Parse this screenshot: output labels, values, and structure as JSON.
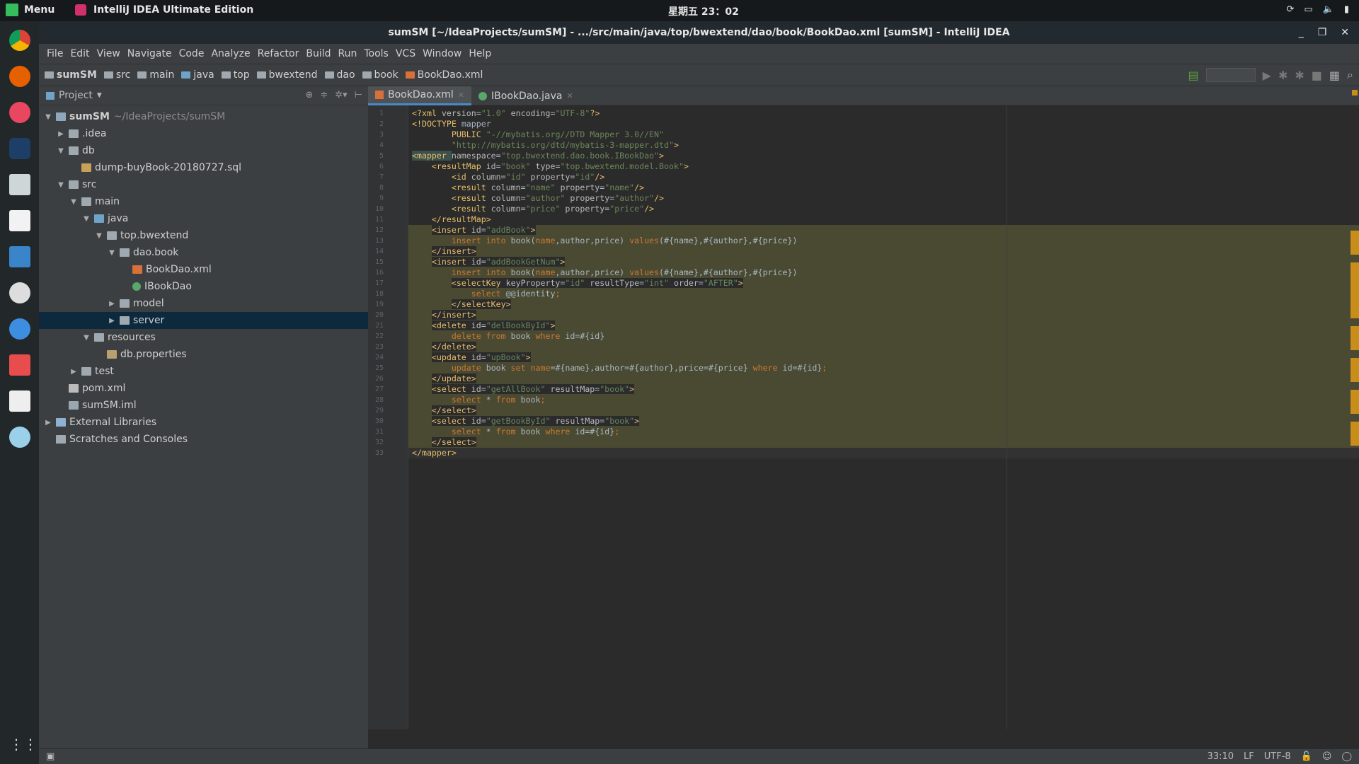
{
  "system_panel": {
    "menu_label": "Menu",
    "app_name": "IntelliJ IDEA Ultimate Edition",
    "clock": "星期五 23：02"
  },
  "window": {
    "title": "sumSM [~/IdeaProjects/sumSM] - .../src/main/java/top/bwextend/dao/book/BookDao.xml [sumSM] - IntelliJ IDEA"
  },
  "menu": [
    "File",
    "Edit",
    "View",
    "Navigate",
    "Code",
    "Analyze",
    "Refactor",
    "Build",
    "Run",
    "Tools",
    "VCS",
    "Window",
    "Help"
  ],
  "breadcrumb": [
    "sumSM",
    "src",
    "main",
    "java",
    "top",
    "bwextend",
    "dao",
    "book",
    "BookDao.xml"
  ],
  "project_panel": {
    "title": "Project",
    "tree": [
      {
        "depth": 0,
        "arrow": "▼",
        "icon": "module",
        "label": "sumSM",
        "note": "~/IdeaProjects/sumSM",
        "bold": true
      },
      {
        "depth": 1,
        "arrow": "▶",
        "icon": "folder",
        "label": ".idea"
      },
      {
        "depth": 1,
        "arrow": "▼",
        "icon": "folder",
        "label": "db"
      },
      {
        "depth": 2,
        "arrow": "",
        "icon": "sql",
        "label": "dump-buyBook-20180727.sql"
      },
      {
        "depth": 1,
        "arrow": "▼",
        "icon": "folder",
        "label": "src"
      },
      {
        "depth": 2,
        "arrow": "▼",
        "icon": "folder",
        "label": "main"
      },
      {
        "depth": 3,
        "arrow": "▼",
        "icon": "source-folder",
        "label": "java"
      },
      {
        "depth": 4,
        "arrow": "▼",
        "icon": "package",
        "label": "top.bwextend"
      },
      {
        "depth": 5,
        "arrow": "▼",
        "icon": "package",
        "label": "dao.book"
      },
      {
        "depth": 6,
        "arrow": "",
        "icon": "xml",
        "label": "BookDao.xml"
      },
      {
        "depth": 6,
        "arrow": "",
        "icon": "interface",
        "label": "IBookDao"
      },
      {
        "depth": 5,
        "arrow": "▶",
        "icon": "package",
        "label": "model"
      },
      {
        "depth": 5,
        "arrow": "▶",
        "icon": "package",
        "label": "server",
        "selected": true
      },
      {
        "depth": 3,
        "arrow": "▼",
        "icon": "resources-folder",
        "label": "resources"
      },
      {
        "depth": 4,
        "arrow": "",
        "icon": "properties",
        "label": "db.properties"
      },
      {
        "depth": 2,
        "arrow": "▶",
        "icon": "folder",
        "label": "test"
      },
      {
        "depth": 1,
        "arrow": "",
        "icon": "maven",
        "label": "pom.xml"
      },
      {
        "depth": 1,
        "arrow": "",
        "icon": "iml",
        "label": "sumSM.iml"
      },
      {
        "depth": 0,
        "arrow": "▶",
        "icon": "libraries",
        "label": "External Libraries"
      },
      {
        "depth": 0,
        "arrow": "",
        "icon": "scratches",
        "label": "Scratches and Consoles"
      }
    ]
  },
  "tabs": [
    {
      "label": "BookDao.xml",
      "active": true,
      "icon": "xml"
    },
    {
      "label": "IBookDao.java",
      "active": false,
      "icon": "interface"
    }
  ],
  "colors": {
    "tag": "#e8bf6a",
    "attr": "#bababa",
    "value": "#6a8759",
    "keyword": "#cc7832",
    "text": "#a9b7c6",
    "highlight": "#4a4a32",
    "marker": "#c98e1a"
  },
  "code": [
    [
      [
        "tag",
        "<?xml "
      ],
      [
        "attr",
        "version"
      ],
      [
        "pl",
        "="
      ],
      [
        "val",
        "\"1.0\""
      ],
      [
        "pl",
        " "
      ],
      [
        "attr",
        "encoding"
      ],
      [
        "pl",
        "="
      ],
      [
        "val",
        "\"UTF-8\""
      ],
      [
        "tag",
        "?>"
      ]
    ],
    [
      [
        "tag",
        "<!DOCTYPE "
      ],
      [
        "txt",
        "mapper"
      ]
    ],
    [
      [
        "sp",
        "        "
      ],
      [
        "tag",
        "PUBLIC "
      ],
      [
        "val",
        "\"-//mybatis.org//DTD Mapper 3.0//EN\""
      ]
    ],
    [
      [
        "sp",
        "        "
      ],
      [
        "val",
        "\"http://mybatis.org/dtd/mybatis-3-mapper.dtd\""
      ],
      [
        "tag",
        ">"
      ]
    ],
    [
      [
        "tag",
        "<mapper "
      ],
      [
        "attr",
        "namespace"
      ],
      [
        "pl",
        "="
      ],
      [
        "val",
        "\"top.bwextend.dao.book.IBookDao\""
      ],
      [
        "tag",
        ">"
      ]
    ],
    [
      [
        "sp",
        "    "
      ],
      [
        "tag",
        "<resultMap "
      ],
      [
        "attr",
        "id"
      ],
      [
        "pl",
        "="
      ],
      [
        "val",
        "\"book\""
      ],
      [
        "pl",
        " "
      ],
      [
        "attr",
        "type"
      ],
      [
        "pl",
        "="
      ],
      [
        "val",
        "\"top.bwextend.model.Book\""
      ],
      [
        "tag",
        ">"
      ]
    ],
    [
      [
        "sp",
        "        "
      ],
      [
        "tag",
        "<id "
      ],
      [
        "attr",
        "column"
      ],
      [
        "pl",
        "="
      ],
      [
        "val",
        "\"id\""
      ],
      [
        "pl",
        " "
      ],
      [
        "attr",
        "property"
      ],
      [
        "pl",
        "="
      ],
      [
        "val",
        "\"id\""
      ],
      [
        "tag",
        "/>"
      ]
    ],
    [
      [
        "sp",
        "        "
      ],
      [
        "tag",
        "<result "
      ],
      [
        "attr",
        "column"
      ],
      [
        "pl",
        "="
      ],
      [
        "val",
        "\"name\""
      ],
      [
        "pl",
        " "
      ],
      [
        "attr",
        "property"
      ],
      [
        "pl",
        "="
      ],
      [
        "val",
        "\"name\""
      ],
      [
        "tag",
        "/>"
      ]
    ],
    [
      [
        "sp",
        "        "
      ],
      [
        "tag",
        "<result "
      ],
      [
        "attr",
        "column"
      ],
      [
        "pl",
        "="
      ],
      [
        "val",
        "\"author\""
      ],
      [
        "pl",
        " "
      ],
      [
        "attr",
        "property"
      ],
      [
        "pl",
        "="
      ],
      [
        "val",
        "\"author\""
      ],
      [
        "tag",
        "/>"
      ]
    ],
    [
      [
        "sp",
        "        "
      ],
      [
        "tag",
        "<result "
      ],
      [
        "attr",
        "column"
      ],
      [
        "pl",
        "="
      ],
      [
        "val",
        "\"price\""
      ],
      [
        "pl",
        " "
      ],
      [
        "attr",
        "property"
      ],
      [
        "pl",
        "="
      ],
      [
        "val",
        "\"price\""
      ],
      [
        "tag",
        "/>"
      ]
    ],
    [
      [
        "sp",
        "    "
      ],
      [
        "tag",
        "</resultMap>"
      ]
    ],
    [
      [
        "sp",
        "    "
      ],
      [
        "tag",
        "<insert "
      ],
      [
        "attr",
        "id"
      ],
      [
        "pl",
        "="
      ],
      [
        "val",
        "\"addBook\""
      ],
      [
        "tag",
        ">"
      ]
    ],
    [
      [
        "sp",
        "        "
      ],
      [
        "kw",
        "insert into "
      ],
      [
        "txt",
        "book("
      ],
      [
        "kw",
        "name"
      ],
      [
        "txt",
        ",author,price) "
      ],
      [
        "kw",
        "values"
      ],
      [
        "txt",
        "(#{name},#{author},#{price})"
      ]
    ],
    [
      [
        "sp",
        "    "
      ],
      [
        "tag",
        "</insert>"
      ]
    ],
    [
      [
        "sp",
        "    "
      ],
      [
        "tag",
        "<insert "
      ],
      [
        "attr",
        "id"
      ],
      [
        "pl",
        "="
      ],
      [
        "val",
        "\"addBookGetNum\""
      ],
      [
        "tag",
        ">"
      ]
    ],
    [
      [
        "sp",
        "        "
      ],
      [
        "kw",
        "insert into "
      ],
      [
        "txt",
        "book("
      ],
      [
        "kw",
        "name"
      ],
      [
        "txt",
        ",author,price) "
      ],
      [
        "kw",
        "values"
      ],
      [
        "txt",
        "(#{name},#{author},#{price})"
      ]
    ],
    [
      [
        "sp",
        "        "
      ],
      [
        "tag",
        "<selectKey "
      ],
      [
        "attr",
        "keyProperty"
      ],
      [
        "pl",
        "="
      ],
      [
        "val",
        "\"id\""
      ],
      [
        "pl",
        " "
      ],
      [
        "attr",
        "resultType"
      ],
      [
        "pl",
        "="
      ],
      [
        "val",
        "\"int\""
      ],
      [
        "pl",
        " "
      ],
      [
        "attr",
        "order"
      ],
      [
        "pl",
        "="
      ],
      [
        "val",
        "\"AFTER\""
      ],
      [
        "tag",
        ">"
      ]
    ],
    [
      [
        "sp",
        "            "
      ],
      [
        "kw",
        "select "
      ],
      [
        "txt",
        "@@identity"
      ],
      [
        "kw",
        ";"
      ]
    ],
    [
      [
        "sp",
        "        "
      ],
      [
        "tag",
        "</selectKey>"
      ]
    ],
    [
      [
        "sp",
        "    "
      ],
      [
        "tag",
        "</insert>"
      ]
    ],
    [
      [
        "sp",
        "    "
      ],
      [
        "tag",
        "<delete "
      ],
      [
        "attr",
        "id"
      ],
      [
        "pl",
        "="
      ],
      [
        "val",
        "\"delBookById\""
      ],
      [
        "tag",
        ">"
      ]
    ],
    [
      [
        "sp",
        "        "
      ],
      [
        "kw",
        "delete from "
      ],
      [
        "txt",
        "book "
      ],
      [
        "kw",
        "where "
      ],
      [
        "txt",
        "id=#{id}"
      ]
    ],
    [
      [
        "sp",
        "    "
      ],
      [
        "tag",
        "</delete>"
      ]
    ],
    [
      [
        "sp",
        "    "
      ],
      [
        "tag",
        "<update "
      ],
      [
        "attr",
        "id"
      ],
      [
        "pl",
        "="
      ],
      [
        "val",
        "\"upBook\""
      ],
      [
        "tag",
        ">"
      ]
    ],
    [
      [
        "sp",
        "        "
      ],
      [
        "kw",
        "update "
      ],
      [
        "txt",
        "book "
      ],
      [
        "kw",
        "set name"
      ],
      [
        "txt",
        "=#{name},author=#{author},price=#{price} "
      ],
      [
        "kw",
        "where "
      ],
      [
        "txt",
        "id=#{id}"
      ],
      [
        "kw",
        ";"
      ]
    ],
    [
      [
        "sp",
        "    "
      ],
      [
        "tag",
        "</update>"
      ]
    ],
    [
      [
        "sp",
        "    "
      ],
      [
        "tag",
        "<select "
      ],
      [
        "attr",
        "id"
      ],
      [
        "pl",
        "="
      ],
      [
        "val",
        "\"getAllBook\""
      ],
      [
        "pl",
        " "
      ],
      [
        "attr",
        "resultMap"
      ],
      [
        "pl",
        "="
      ],
      [
        "val",
        "\"book\""
      ],
      [
        "tag",
        ">"
      ]
    ],
    [
      [
        "sp",
        "        "
      ],
      [
        "kw",
        "select "
      ],
      [
        "txt",
        "* "
      ],
      [
        "kw",
        "from "
      ],
      [
        "txt",
        "book"
      ],
      [
        "kw",
        ";"
      ]
    ],
    [
      [
        "sp",
        "    "
      ],
      [
        "tag",
        "</select>"
      ]
    ],
    [
      [
        "sp",
        "    "
      ],
      [
        "tag",
        "<select "
      ],
      [
        "attr",
        "id"
      ],
      [
        "pl",
        "="
      ],
      [
        "val",
        "\"getBookById\""
      ],
      [
        "pl",
        " "
      ],
      [
        "attr",
        "resultMap"
      ],
      [
        "pl",
        "="
      ],
      [
        "val",
        "\"book\""
      ],
      [
        "tag",
        ">"
      ]
    ],
    [
      [
        "sp",
        "        "
      ],
      [
        "kw",
        "select "
      ],
      [
        "txt",
        "* "
      ],
      [
        "kw",
        "from "
      ],
      [
        "txt",
        "book "
      ],
      [
        "kw",
        "where "
      ],
      [
        "txt",
        "id=#{id}"
      ],
      [
        "kw",
        ";"
      ]
    ],
    [
      [
        "sp",
        "    "
      ],
      [
        "tag",
        "</select>"
      ]
    ],
    [
      [
        "tag",
        "</mapper>"
      ]
    ]
  ],
  "highlighted_lines": [
    12,
    32
  ],
  "current_line": 33,
  "status": {
    "position": "33:10",
    "line_sep": "LF",
    "encoding": "UTF-8"
  }
}
